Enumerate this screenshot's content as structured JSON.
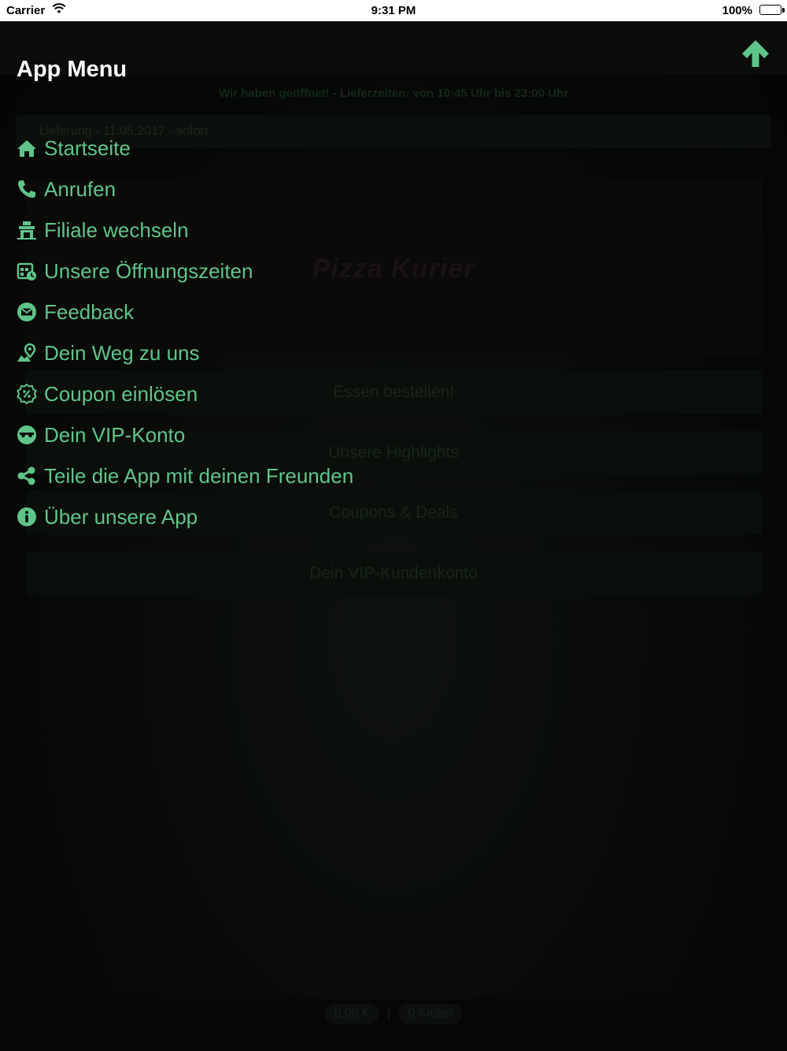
{
  "status_bar": {
    "carrier": "Carrier",
    "time": "9:31 PM",
    "battery": "100%"
  },
  "background": {
    "notice": "Wir haben geöffnet! - Lieferzeiten: von 10:45 Uhr bis 23:00 Uhr",
    "order_info": "Lieferung - 11.05.2017 - sofort",
    "logo_text": "Pizza Kurier",
    "buttons": [
      {
        "label": "Essen bestellen!"
      },
      {
        "label": "Unsere Highlights"
      },
      {
        "label": "Coupons & Deals"
      },
      {
        "label": "Dein VIP-Kundenkonto"
      }
    ],
    "footer": {
      "cart_total": "0,00 €",
      "separator": "|",
      "items": "0 Artikel"
    }
  },
  "menu": {
    "title": "App Menu",
    "accent_color": "#5fc48a",
    "items": [
      {
        "label": "Startseite",
        "icon": "home-icon"
      },
      {
        "label": "Anrufen",
        "icon": "phone-icon"
      },
      {
        "label": "Filiale wechseln",
        "icon": "store-icon"
      },
      {
        "label": "Unsere Öffnungszeiten",
        "icon": "calendar-icon"
      },
      {
        "label": "Feedback",
        "icon": "envelope-icon"
      },
      {
        "label": "Dein Weg zu uns",
        "icon": "map-marker-icon"
      },
      {
        "label": "Coupon einlösen",
        "icon": "coupon-icon"
      },
      {
        "label": "Dein VIP-Konto",
        "icon": "vip-icon"
      },
      {
        "label": "Teile die App mit deinen Freunden",
        "icon": "share-icon"
      },
      {
        "label": "Über unsere App",
        "icon": "info-icon"
      }
    ]
  }
}
